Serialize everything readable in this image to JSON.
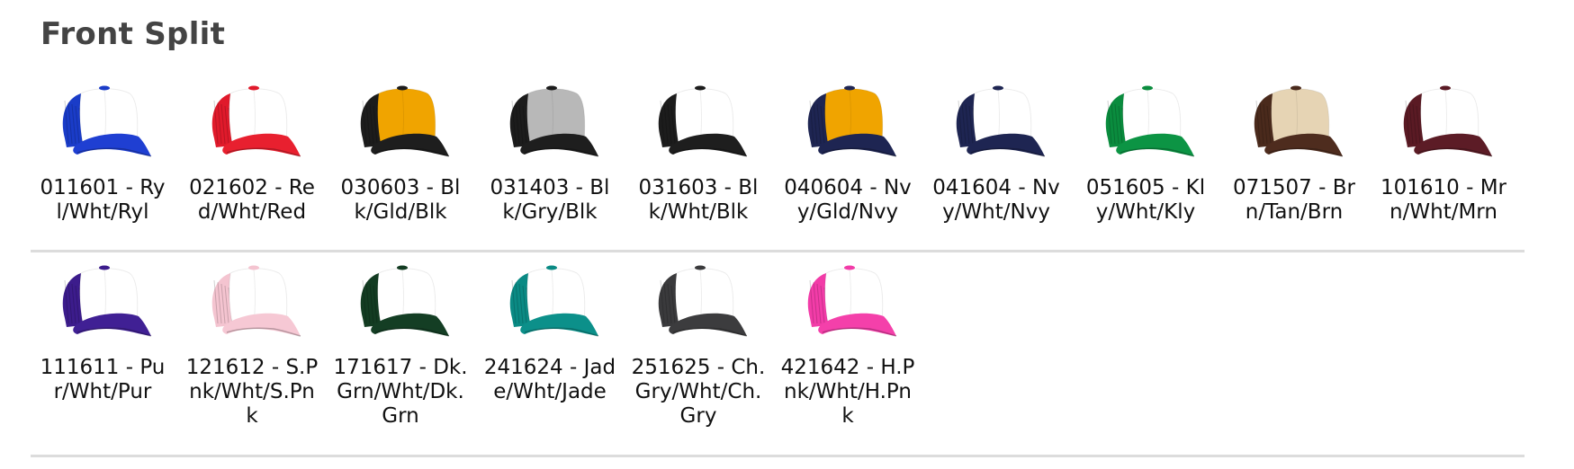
{
  "section": {
    "title": "Front Split"
  },
  "rows": [
    [
      {
        "label": "011601 - Ryl/Wht/Ryl",
        "front": "#ffffff",
        "side": "#1a3cc8",
        "visor": "#1f3fd2",
        "button": "#1a3cc8"
      },
      {
        "label": "021602 - Red/Wht/Red",
        "front": "#ffffff",
        "side": "#e01a2b",
        "visor": "#e8202f",
        "button": "#e01a2b"
      },
      {
        "label": "030603 - Blk/Gld/Blk",
        "front": "#f0a400",
        "side": "#1c1c1c",
        "visor": "#1e1e1e",
        "button": "#1c1c1c"
      },
      {
        "label": "031403 - Blk/Gry/Blk",
        "front": "#b8b8b8",
        "side": "#1c1c1c",
        "visor": "#1e1e1e",
        "button": "#1c1c1c"
      },
      {
        "label": "031603 - Blk/Wht/Blk",
        "front": "#ffffff",
        "side": "#1c1c1c",
        "visor": "#1e1e1e",
        "button": "#1c1c1c"
      },
      {
        "label": "040604 - Nvy/Gld/Nvy",
        "front": "#f0a400",
        "side": "#1e2552",
        "visor": "#1e2552",
        "button": "#1e2552"
      },
      {
        "label": "041604 - Nvy/Wht/Nvy",
        "front": "#ffffff",
        "side": "#1e2552",
        "visor": "#1e2552",
        "button": "#1e2552"
      },
      {
        "label": "051605 - Kly/Wht/Kly",
        "front": "#ffffff",
        "side": "#0a8c3e",
        "visor": "#0c9444",
        "button": "#0a8c3e"
      },
      {
        "label": "071507 - Brn/Tan/Brn",
        "front": "#e6d4b4",
        "side": "#4a2a1c",
        "visor": "#4e2c1e",
        "button": "#4a2a1c"
      },
      {
        "label": "101610 - Mrn/Wht/Mrn",
        "front": "#ffffff",
        "side": "#5a1a24",
        "visor": "#5c1c26",
        "button": "#5a1a24"
      }
    ],
    [
      {
        "label": "111611 - Pur/Wht/Pur",
        "front": "#ffffff",
        "side": "#3c1c8c",
        "visor": "#402094",
        "button": "#3c1c8c"
      },
      {
        "label": "121612 - S.Pnk/Wht/S.Pnk",
        "front": "#ffffff",
        "side": "#f4c4d0",
        "visor": "#f6c8d4",
        "button": "#f4c4d0"
      },
      {
        "label": "171617 - Dk.Grn/Wht/Dk.Grn",
        "front": "#ffffff",
        "side": "#133c22",
        "visor": "#143e24",
        "button": "#133c22"
      },
      {
        "label": "241624 - Jade/Wht/Jade",
        "front": "#ffffff",
        "side": "#0a8a84",
        "visor": "#0c908a",
        "button": "#0a8a84"
      },
      {
        "label": "251625 - Ch.Gry/Wht/Ch.Gry",
        "front": "#ffffff",
        "side": "#3a3a3c",
        "visor": "#3c3c3e",
        "button": "#3a3a3c"
      },
      {
        "label": "421642 - H.Pnk/Wht/H.Pnk",
        "front": "#ffffff",
        "side": "#f23ca8",
        "visor": "#f440aa",
        "button": "#f23ca8"
      }
    ]
  ]
}
